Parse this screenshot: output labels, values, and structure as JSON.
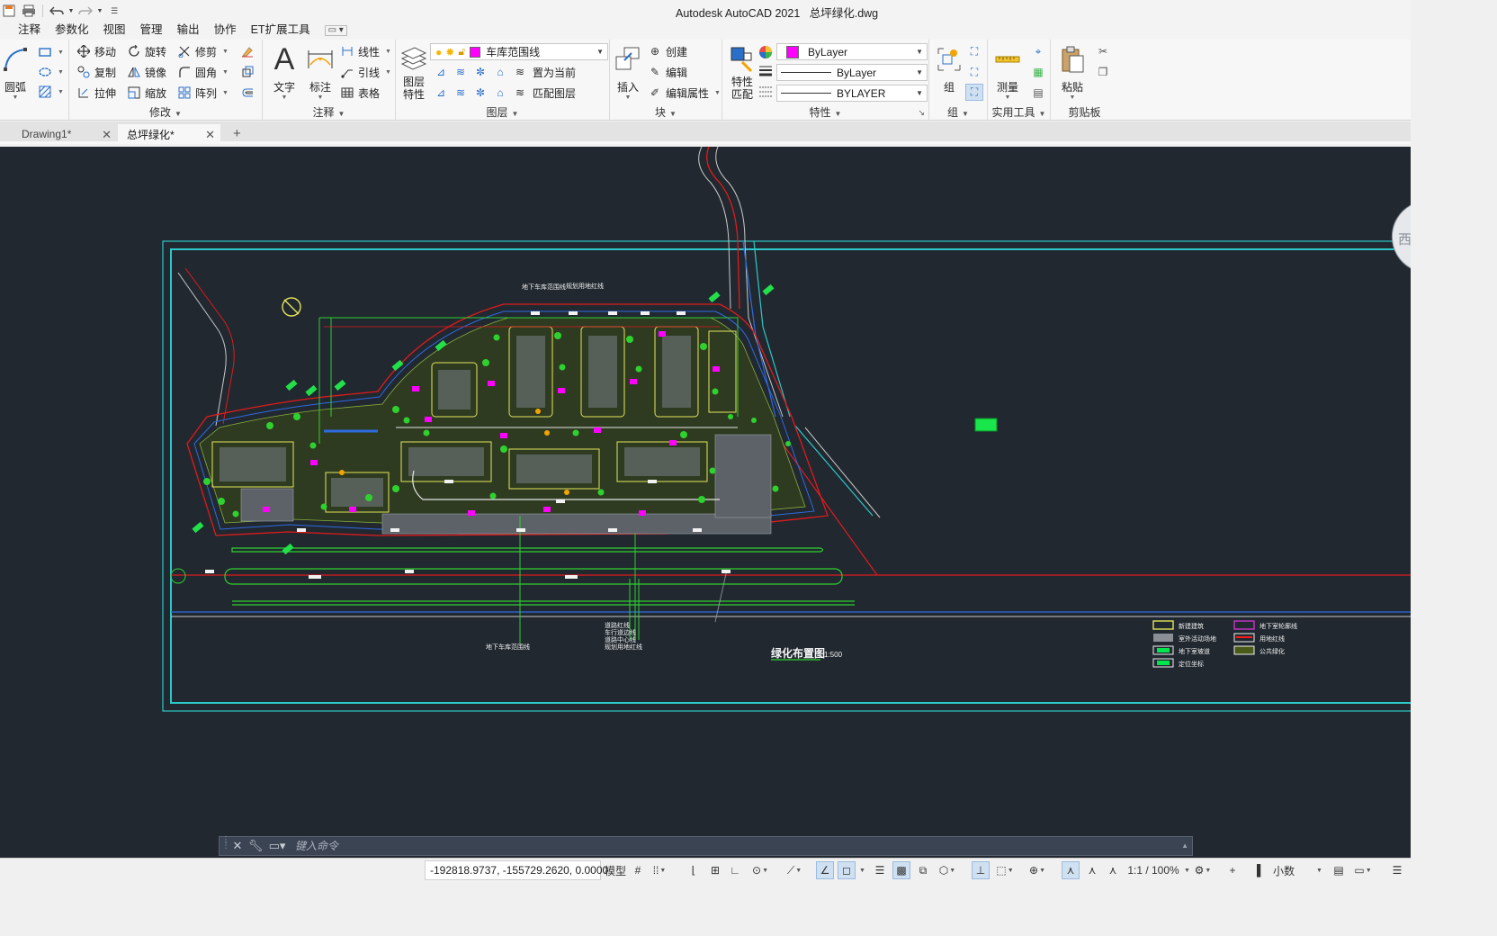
{
  "titlebar": {
    "app_title": "Autodesk AutoCAD 2021",
    "file_name": "总坪绿化.dwg"
  },
  "menu": {
    "tabs": [
      "注释",
      "参数化",
      "视图",
      "管理",
      "输出",
      "协作",
      "ET扩展工具"
    ]
  },
  "ribbon": {
    "draw": {
      "arc_label": "圆弧"
    },
    "modify": {
      "title": "修改",
      "move": "移动",
      "rotate": "旋转",
      "trim": "修剪",
      "copy": "复制",
      "mirror": "镜像",
      "fillet": "圆角",
      "stretch": "拉伸",
      "scale": "缩放",
      "array": "阵列"
    },
    "annotation": {
      "title": "注释",
      "text": "文字",
      "dimension": "标注",
      "linear": "线性",
      "leader": "引线",
      "table": "表格"
    },
    "layers": {
      "title": "图层",
      "layer_properties": "图层\n特性",
      "layer_properties_l1": "图层",
      "layer_properties_l2": "特性",
      "current_layer": "车库范围线",
      "set_current": "置为当前",
      "match_layer": "匹配图层"
    },
    "block": {
      "title": "块",
      "insert": "插入",
      "create": "创建",
      "edit": "编辑",
      "edit_attributes": "编辑属性"
    },
    "properties": {
      "title": "特性",
      "match_l1": "特性",
      "match_l2": "匹配",
      "color": "ByLayer",
      "linetype": "ByLayer",
      "lineweight": "BYLAYER"
    },
    "groups": {
      "title": "组",
      "group": "组"
    },
    "utilities": {
      "title": "实用工具",
      "measure": "测量"
    },
    "clipboard": {
      "title": "剪贴板",
      "paste": "粘贴"
    }
  },
  "doc_tabs": [
    {
      "label": "Drawing1*",
      "active": false
    },
    {
      "label": "总坪绿化*",
      "active": true
    }
  ],
  "drawing": {
    "plan_title": "绿化布置图",
    "plan_scale": "1:500",
    "viewcube_face": "西",
    "labels": {
      "garage_boundary": "地下车库范围线",
      "planning_line": "规划用地红线",
      "road_lines": [
        "道路红线",
        "车行道边线",
        "道路中心线",
        "规划用地红线"
      ]
    },
    "legend": [
      {
        "label": "新建建筑",
        "color": "#e4e45a"
      },
      {
        "label": "室外活动场地",
        "color": "#8a8f96"
      },
      {
        "label": "地下室坡道",
        "color": "#00e64d"
      },
      {
        "label": "定位坐标",
        "color": "#00e64d"
      },
      {
        "label": "地下室轮廓线",
        "color": "#cc33cc"
      },
      {
        "label": "用地红线",
        "color": "#ff1a1a"
      },
      {
        "label": "公共绿化",
        "color": "#4a5a18"
      }
    ]
  },
  "command_line": {
    "placeholder": "键入命令"
  },
  "statusbar": {
    "coordinates": "-192818.9737, -155729.2620, 0.0000",
    "model": "模型",
    "scale": "1:1 / 100%",
    "units": "小数"
  },
  "colors": {
    "canvas": "#212830",
    "cyan_frame": "#2ec7c7",
    "red_line": "#e01b1b",
    "green_line": "#2fd12f",
    "magenta": "#ff00ff"
  }
}
